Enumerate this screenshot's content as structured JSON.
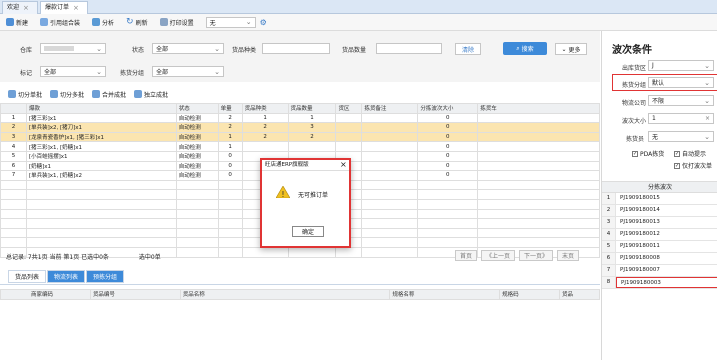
{
  "tabs": [
    {
      "label": "欢迎"
    },
    {
      "label": "爆款订单"
    }
  ],
  "toolbar": {
    "new": "新建",
    "quote_combo": "引用组合装",
    "analyze": "分析",
    "refresh": "刷新",
    "print_settings": "打印设置",
    "print_value": "无"
  },
  "filter": {
    "warehouse_label": "仓库",
    "status_label": "状态",
    "status_value": "全部",
    "product_types_label": "货品种类",
    "product_count_label": "货品数量",
    "clear": "清除",
    "search": "搜索",
    "more": "更多",
    "mark_label": "标记",
    "mark_value": "全部",
    "picking_group_label": "拣货分组",
    "picking_group_value": "全部"
  },
  "subtoolbar": {
    "split_single": "切分单批",
    "split_multi": "切分多批",
    "merge": "合并成批",
    "standalone": "独立成批"
  },
  "table": {
    "headers": [
      "",
      "爆款",
      "状态",
      "单量",
      "货品种类",
      "货品数量",
      "货区",
      "拣货备注",
      "分拣波次大小",
      "拣货车"
    ],
    "rows": [
      {
        "n": "1",
        "name": "[猪三彩]x1",
        "status": "自动检测",
        "qty": "2",
        "types": "1",
        "count": "1",
        "size": "0",
        "hl": false
      },
      {
        "n": "2",
        "name": "[单兵装]x2, [猪刀]x1",
        "status": "自动检测",
        "qty": "2",
        "types": "2",
        "count": "3",
        "size": "0",
        "hl": true
      },
      {
        "n": "3",
        "name": "[龙泉青瓷香炉]x1, [猪三彩]x1",
        "status": "自动检测",
        "qty": "1",
        "types": "2",
        "count": "2",
        "size": "0",
        "hl": true
      },
      {
        "n": "4",
        "name": "[猪三彩]x1, [奶糖]x1",
        "status": "自动检测",
        "qty": "1",
        "types": "",
        "count": "",
        "size": "0",
        "hl": false
      },
      {
        "n": "5",
        "name": "[小百蛙摇摆]x1",
        "status": "自动检测",
        "qty": "0",
        "types": "",
        "count": "",
        "size": "0",
        "hl": false
      },
      {
        "n": "6",
        "name": "[奶糖]x1",
        "status": "自动检测",
        "qty": "0",
        "types": "",
        "count": "",
        "size": "0",
        "hl": false
      },
      {
        "n": "7",
        "name": "[单兵装]x1, [奶糖]x2",
        "status": "自动检测",
        "qty": "0",
        "types": "",
        "count": "",
        "size": "0",
        "hl": false
      }
    ]
  },
  "status": {
    "summary": "总记录: 7共1页 当前 第1页 已选中0条",
    "selected": "选中0单"
  },
  "pager": {
    "first": "首页",
    "prev": "《上一页",
    "next": "下一页》",
    "last": "末页"
  },
  "bottom_tabs": [
    "货品列表",
    "物流列表",
    "预拣分组"
  ],
  "bottom_headers": [
    "商家编码",
    "货品编号",
    "货品名称",
    "规格名称",
    "规格码",
    "货品"
  ],
  "right": {
    "title": "波次条件",
    "warehouse_area_label": "出库货区",
    "warehouse_area_value": "J",
    "picking_group_label": "拣货分组",
    "picking_group_value": "默认",
    "logistics_label": "物流公司",
    "logistics_value": "不限",
    "wave_size_label": "波次大小",
    "wave_size_value": "1",
    "picker_label": "拣货员",
    "picker_value": "无",
    "pda_label": "PDA拣货",
    "auto_tip_label": "自动提示",
    "print_label": "仅打波次单",
    "wave_list_header": "分拣波次",
    "waves": [
      {
        "n": "1",
        "code": "PJ1909180015"
      },
      {
        "n": "2",
        "code": "PJ1909180014"
      },
      {
        "n": "3",
        "code": "PJ1909180013"
      },
      {
        "n": "4",
        "code": "PJ1909180012"
      },
      {
        "n": "5",
        "code": "PJ1909180011"
      },
      {
        "n": "6",
        "code": "PJ1909180008"
      },
      {
        "n": "7",
        "code": "PJ1909180007"
      },
      {
        "n": "8",
        "code": "PJ1909180003"
      }
    ]
  },
  "dialog": {
    "title": "旺店通ERP旗舰版",
    "message": "无可推订单",
    "ok": "确定"
  }
}
